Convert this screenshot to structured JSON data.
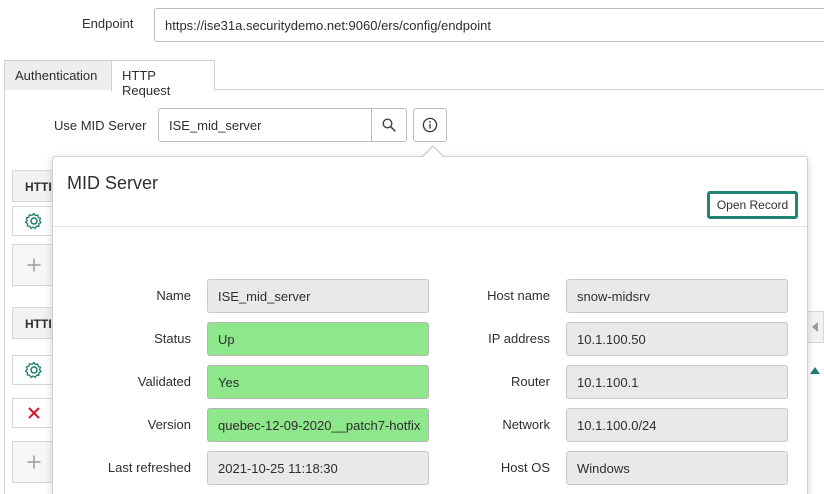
{
  "endpoint": {
    "label": "Endpoint",
    "value": "https://ise31a.securitydemo.net:9060/ers/config/endpoint"
  },
  "tabs": [
    {
      "label": "Authentication"
    },
    {
      "label": "HTTP Request"
    }
  ],
  "mid_server": {
    "label": "Use MID Server",
    "value": "ISE_mid_server"
  },
  "background": {
    "section1_head": "HTTI",
    "section2_head": "HTTI"
  },
  "popover": {
    "title": "MID Server",
    "open_record_label": "Open Record",
    "left_fields": [
      {
        "label": "Name",
        "value": "ISE_mid_server",
        "highlight": false
      },
      {
        "label": "Status",
        "value": "Up",
        "highlight": true
      },
      {
        "label": "Validated",
        "value": "Yes",
        "highlight": true
      },
      {
        "label": "Version",
        "value": "quebec-12-09-2020__patch7-hotfix",
        "highlight": true
      },
      {
        "label": "Last refreshed",
        "value": "2021-10-25 11:18:30",
        "highlight": false
      }
    ],
    "right_fields": [
      {
        "label": "Host name",
        "value": "snow-midsrv"
      },
      {
        "label": "IP address",
        "value": "10.1.100.50"
      },
      {
        "label": "Router",
        "value": "10.1.100.1"
      },
      {
        "label": "Network",
        "value": "10.1.100.0/24"
      },
      {
        "label": "Host OS",
        "value": "Windows"
      }
    ]
  },
  "colors": {
    "highlight_green": "#8ee78a",
    "open_record_border": "#1f8476",
    "delete_red": "#d6182b",
    "accent_teal": "#1d7c6f"
  },
  "icons": [
    "search-icon",
    "info-icon",
    "gear-icon",
    "plus-icon",
    "close-icon",
    "caret-left-icon",
    "caret-up-icon"
  ]
}
